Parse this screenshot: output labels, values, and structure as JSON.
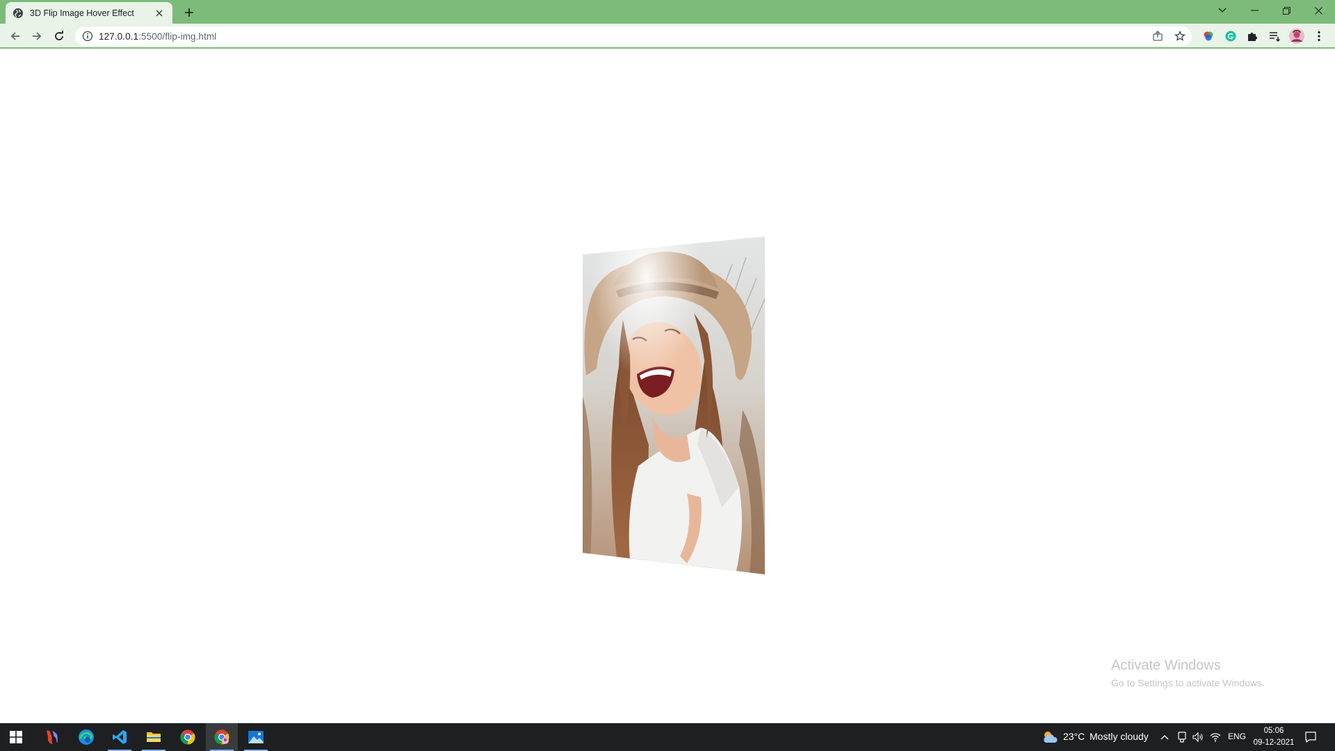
{
  "browser": {
    "tab": {
      "title": "3D Flip Image Hover Effect",
      "favicon": "globe-icon"
    },
    "address": {
      "host": "127.0.0.1",
      "rest": ":5500/flip-img.html"
    },
    "accent_color": "#7dbb7a"
  },
  "page": {
    "image": {
      "description_icon": "flip-image",
      "state": "mid-flip (3D rotated)"
    },
    "watermark": {
      "title": "Activate Windows",
      "subtitle": "Go to Settings to activate Windows."
    }
  },
  "taskbar": {
    "pinned": [
      "windows-start-icon",
      "photoshop-icon",
      "edge-icon",
      "vscode-icon",
      "file-explorer-icon",
      "chrome-icon",
      "chrome-profile-icon",
      "photos-icon"
    ],
    "weather": {
      "temp": "23°C",
      "condition": "Mostly cloudy"
    },
    "lang": "ENG",
    "time": "05:06",
    "date": "09-12-2021"
  }
}
